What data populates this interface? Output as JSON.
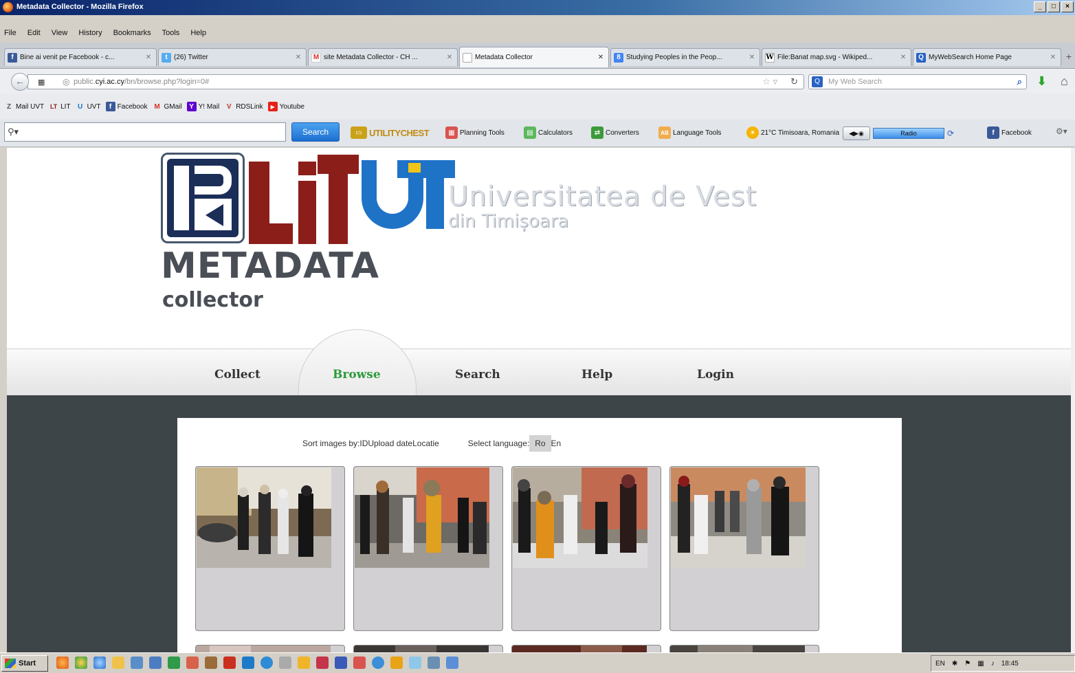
{
  "window": {
    "title": "Metadata Collector - Mozilla Firefox",
    "controls": [
      "_",
      "□",
      "×"
    ]
  },
  "menubar": [
    "File",
    "Edit",
    "View",
    "History",
    "Bookmarks",
    "Tools",
    "Help"
  ],
  "tabs": [
    {
      "label": "Bine ai venit pe Facebook - c...",
      "icon": "facebook-icon",
      "color": "#3b5998",
      "glyph": "f"
    },
    {
      "label": "(26) Twitter",
      "icon": "twitter-icon",
      "color": "#55acee",
      "glyph": "t"
    },
    {
      "label": "site Metadata Collector - CH ...",
      "icon": "gmail-icon",
      "color": "#d93025",
      "glyph": "M"
    },
    {
      "label": "Metadata Collector",
      "icon": "blank-page-icon",
      "color": "#ffffff",
      "glyph": ""
    },
    {
      "label": "Studying Peoples in the Peop...",
      "icon": "google-scholar-icon",
      "color": "#4285f4",
      "glyph": "8"
    },
    {
      "label": "File:Banat map.svg - Wikiped...",
      "icon": "wikipedia-icon",
      "color": "#ffffff",
      "glyph": "W"
    },
    {
      "label": "MyWebSearch Home Page",
      "icon": "mywebsearch-icon",
      "color": "#2862c4",
      "glyph": "Q"
    }
  ],
  "navbar": {
    "url_prefix": "public.",
    "url_domain": "cyi.ac.cy",
    "url_path": "/bn/browse.php?login=0#",
    "search_placeholder": "My Web Search"
  },
  "bookmarks": [
    {
      "label": "Mail UVT",
      "icon": "uvt-mail-icon",
      "color": "#555555",
      "glyph": "Z"
    },
    {
      "label": "LIT",
      "icon": "lit-icon",
      "color": "#8c1e1a",
      "glyph": "LT"
    },
    {
      "label": "UVT",
      "icon": "uvt-icon",
      "color": "#1f73c7",
      "glyph": "U"
    },
    {
      "label": "Facebook",
      "icon": "facebook-icon",
      "color": "#3b5998",
      "glyph": "f"
    },
    {
      "label": "GMail",
      "icon": "gmail-icon",
      "color": "#d93025",
      "glyph": "M"
    },
    {
      "label": "Y! Mail",
      "icon": "yahoo-mail-icon",
      "color": "#5f01d1",
      "glyph": "Y"
    },
    {
      "label": "RDSLink",
      "icon": "rdslink-icon",
      "color": "#c0392b",
      "glyph": "V"
    },
    {
      "label": "Youtube",
      "icon": "youtube-icon",
      "color": "#e62117",
      "glyph": "▶"
    }
  ],
  "toolbar": {
    "search_button": "Search",
    "utility_chest": "UTILITYCHEST",
    "items": [
      {
        "label": "Planning Tools",
        "icon": "calendar-icon",
        "color": "#d9534f",
        "glyph": "▦"
      },
      {
        "label": "Calculators",
        "icon": "calculator-icon",
        "color": "#5cb85c",
        "glyph": "▤"
      },
      {
        "label": "Converters",
        "icon": "converter-icon",
        "color": "#3c9a3c",
        "glyph": "⇄"
      },
      {
        "label": "Language Tools",
        "icon": "language-icon",
        "color": "#f0ad4e",
        "glyph": "AB"
      },
      {
        "label": "21°C Timisoara, Romania",
        "icon": "weather-sun-icon",
        "color": "#f5b400",
        "glyph": "☀"
      }
    ],
    "radio_label": "Radio",
    "facebook_label": "Facebook"
  },
  "site": {
    "logo_title": "Universitatea de Vest",
    "logo_subtitle": "din Timișoara",
    "brand_line1": "METADATA",
    "brand_line2": "collector",
    "nav": [
      {
        "label": "Collect",
        "active": false
      },
      {
        "label": "Browse",
        "active": true
      },
      {
        "label": "Search",
        "active": false
      },
      {
        "label": "Help",
        "active": false
      },
      {
        "label": "Login",
        "active": false
      }
    ],
    "controls": {
      "sort_label": "Sort images by:",
      "sort_options": [
        "ID",
        "Upload date",
        "Locatie"
      ],
      "language_label": "Select language:",
      "languages": [
        "Ro",
        "En"
      ],
      "selected_language": "Ro"
    },
    "thumbnails_count_visible_rows": 2
  },
  "taskbar": {
    "start_label": "Start",
    "language": "EN",
    "time": "18:45"
  },
  "colors": {
    "nav_active": "#2b9a3a",
    "dark_bg": "#3d4549",
    "lit_red": "#8c1e1a",
    "uvt_blue": "#1f73c7",
    "ipk_navy": "#1b2e58"
  }
}
